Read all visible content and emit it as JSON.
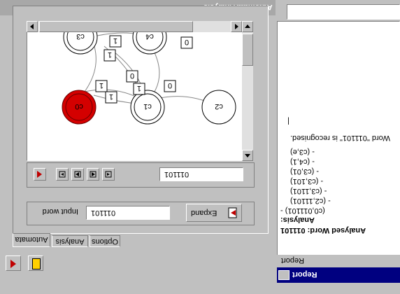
{
  "left_window": {
    "title": "Automata Analysis"
  },
  "tabs": [
    "Automata",
    "Analysis",
    "Options"
  ],
  "input_group": {
    "label": "Input word",
    "value": "011101",
    "expand_label": "Expand"
  },
  "playback": {
    "word": "011101"
  },
  "graph": {
    "states": [
      "c3",
      "c4",
      "c1",
      "c2",
      "c0"
    ],
    "edge_labels": [
      "1",
      "1",
      "0",
      "0",
      "1",
      "1",
      "1",
      "0"
    ]
  },
  "report_window": {
    "title": "Report",
    "menu": "Report",
    "lines": [
      "Analysed Word: 011101",
      "Analysis:",
      "(c0,011101) -",
      "- (c2,11101)",
      "- (c3,1101)",
      "- (c3,101)",
      "- (c3,01)",
      "- (c4,1)",
      "- (c3,e)",
      "Word \"011101\" is recognised.",
      "|"
    ]
  },
  "colors": {
    "active_state": "#d40000",
    "title_active": "#000080"
  }
}
